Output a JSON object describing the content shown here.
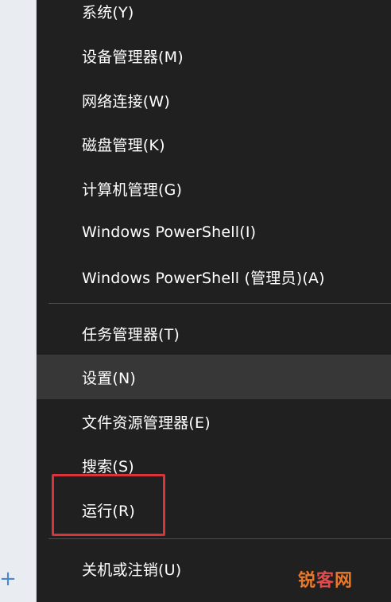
{
  "left_panel": {
    "add_button_label": "+"
  },
  "menu": {
    "group1": [
      {
        "label": "系统(Y)"
      },
      {
        "label": "设备管理器(M)"
      },
      {
        "label": "网络连接(W)"
      },
      {
        "label": "磁盘管理(K)"
      },
      {
        "label": "计算机管理(G)"
      },
      {
        "label": "Windows PowerShell(I)"
      },
      {
        "label": "Windows PowerShell (管理员)(A)"
      }
    ],
    "group2": [
      {
        "label": "任务管理器(T)"
      },
      {
        "label": "设置(N)",
        "hovered": true
      },
      {
        "label": "文件资源管理器(E)"
      },
      {
        "label": "搜索(S)"
      },
      {
        "label": "运行(R)",
        "highlighted": true
      }
    ],
    "group3": [
      {
        "label": "关机或注销(U)"
      }
    ]
  },
  "annotation": {
    "highlight_color": "#d9343a",
    "highlight_target": "运行(R)"
  },
  "watermark": {
    "part1": "锐",
    "part2": "客",
    "part3": "网"
  },
  "colors": {
    "menu_background": "#202020",
    "hover_background": "#373737",
    "text": "#ffffff",
    "separator": "#4c4c4c"
  }
}
